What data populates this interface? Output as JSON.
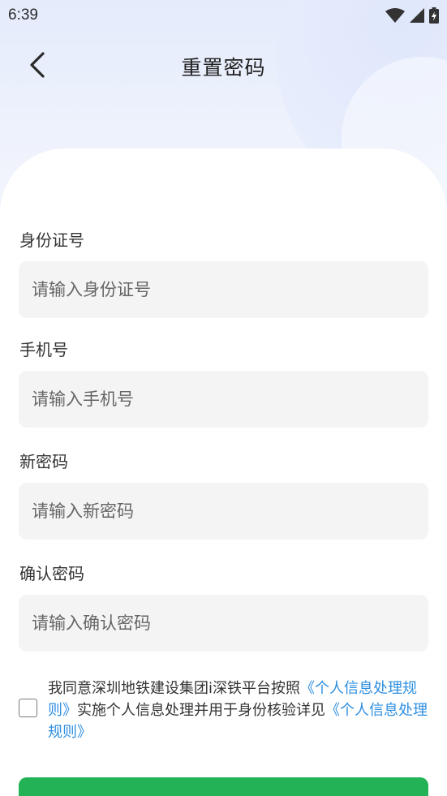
{
  "status_bar": {
    "time": "6:39",
    "icons": [
      "wifi-icon",
      "signal-icon",
      "battery-charging-icon"
    ]
  },
  "nav": {
    "back_icon": "chevron-left-icon",
    "title": "重置密码"
  },
  "form": {
    "id_card": {
      "label": "身份证号",
      "placeholder": "请输入身份证号",
      "value": ""
    },
    "phone": {
      "label": "手机号",
      "placeholder": "请输入手机号",
      "value": ""
    },
    "new_password": {
      "label": "新密码",
      "placeholder": "请输入新密码",
      "value": ""
    },
    "confirm_password": {
      "label": "确认密码",
      "placeholder": "请输入确认密码",
      "value": ""
    }
  },
  "agreement": {
    "checked": false,
    "text_1": "我同意深圳地铁建设集团i深铁平台按照",
    "link_1": "《个人信息处理规则》",
    "text_2": "实施个人信息处理并用于身份核验详见",
    "link_2": "《个人信息处理规则》"
  },
  "colors": {
    "accent_green": "#23b256",
    "link_blue": "#2f8fe0",
    "input_bg": "#f4f4f4"
  }
}
